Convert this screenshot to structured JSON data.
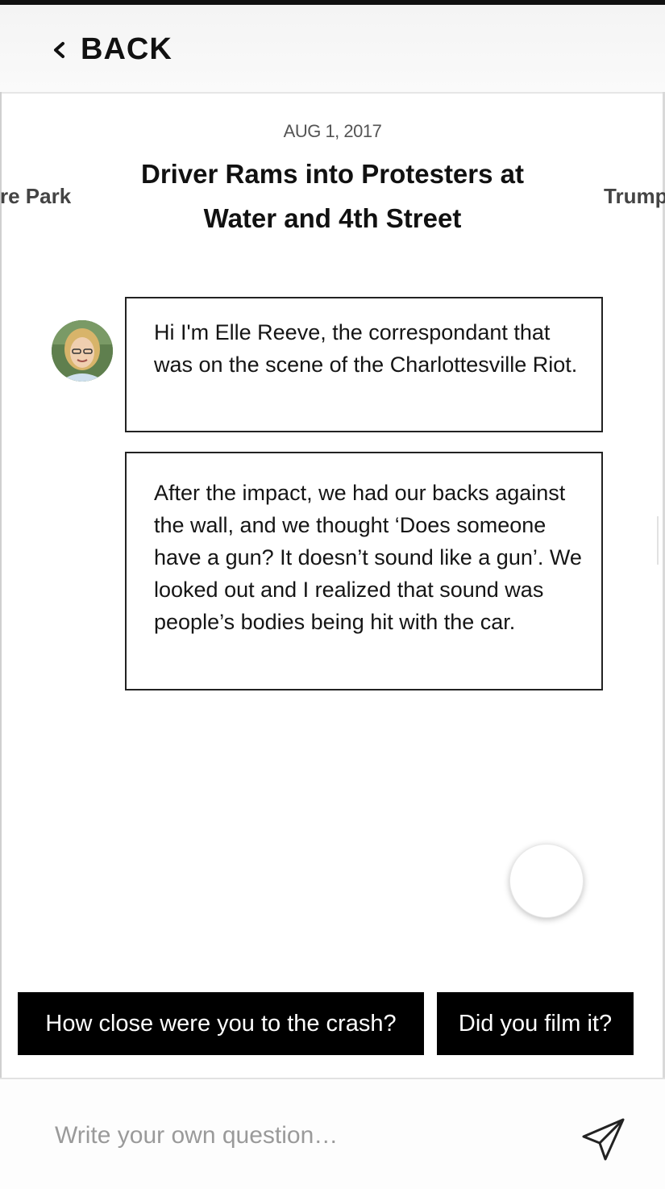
{
  "header": {
    "back_label": "BACK"
  },
  "story": {
    "date": "AUG 1, 2017",
    "title": "Driver Rams into Protesters at Water and 4th Street",
    "prev_story_fragment": "re Park",
    "next_story_fragment": "Trump"
  },
  "chat": {
    "messages": [
      {
        "text": "Hi I'm Elle Reeve, the correspondant that was on the scene of the Charlottesville Riot."
      },
      {
        "text": "After the impact, we had our backs against the wall, and we thought ‘Does someone have a gun? It doesn’t sound like a gun’. We looked out and I realized that sound was people’s bodies being hit with the car."
      }
    ]
  },
  "suggestions": [
    {
      "label": "How close were you to the crash?"
    },
    {
      "label": "Did you film it?"
    }
  ],
  "composer": {
    "placeholder": "Write your own question…"
  },
  "icons": {
    "back": "chevron-left-icon",
    "send": "paper-plane-icon"
  },
  "colors": {
    "chip_background": "#000000",
    "chip_text": "#ffffff",
    "bubble_border": "#222222"
  }
}
